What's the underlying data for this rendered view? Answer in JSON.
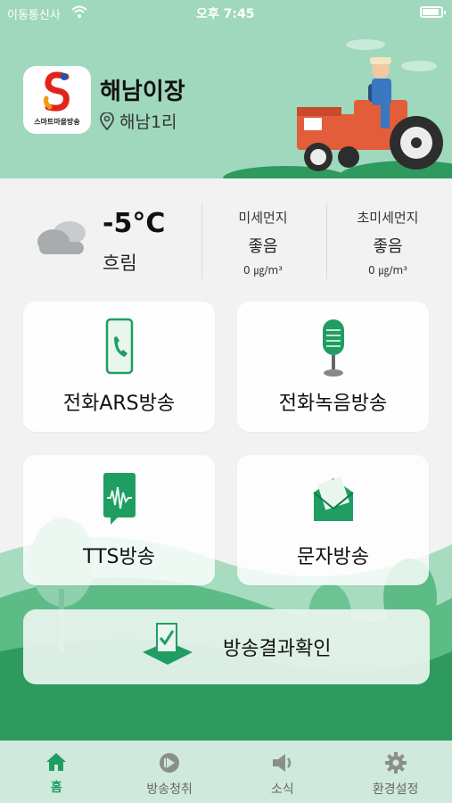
{
  "status_bar": {
    "carrier": "이동통신사",
    "time": "오후 7:45",
    "battery_level": 0.9
  },
  "header": {
    "logo_caption": "스마트마을방송",
    "village_name": "해남이장",
    "location": "해남1리"
  },
  "weather": {
    "temperature": "-5°C",
    "condition": "흐림",
    "fine_dust": {
      "title": "미세먼지",
      "grade": "좋음",
      "value": "0 ㎍/m³"
    },
    "ultra_fine_dust": {
      "title": "초미세먼지",
      "grade": "좋음",
      "value": "0 ㎍/m³"
    }
  },
  "menu": {
    "phone_ars": "전화ARS방송",
    "phone_record": "전화녹음방송",
    "tts": "TTS방송",
    "sms": "문자방송",
    "result": "방송결과확인"
  },
  "tabs": [
    {
      "label": "홈",
      "icon": "home-icon",
      "active": true
    },
    {
      "label": "방송청취",
      "icon": "play-icon",
      "active": false
    },
    {
      "label": "소식",
      "icon": "speaker-icon",
      "active": false
    },
    {
      "label": "환경설정",
      "icon": "gear-icon",
      "active": false
    }
  ],
  "colors": {
    "accent": "#1f9d63",
    "header_bg": "#9fd8bd",
    "tabbar_bg": "#cfe9dd"
  }
}
